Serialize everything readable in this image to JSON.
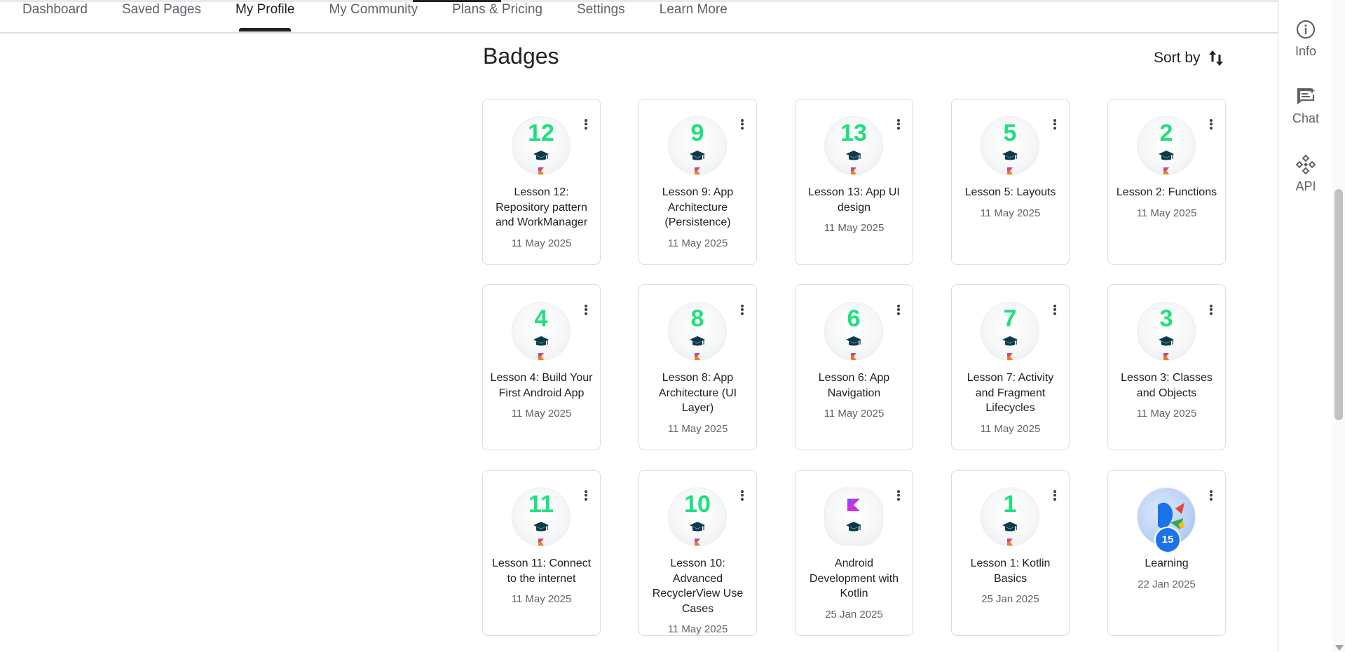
{
  "nav": {
    "tabs": [
      {
        "label": "Dashboard"
      },
      {
        "label": "Saved Pages"
      },
      {
        "label": "My Profile",
        "active": true
      },
      {
        "label": "My Community"
      },
      {
        "label": "Plans & Pricing"
      },
      {
        "label": "Settings"
      },
      {
        "label": "Learn More"
      }
    ]
  },
  "rail": {
    "info": "Info",
    "chat": "Chat",
    "api": "API"
  },
  "badges": {
    "title": "Badges",
    "sort_label": "Sort by",
    "accent_color": "#1ee07d",
    "items": [
      {
        "number": "12",
        "title": "Lesson 12: Repository pattern and WorkManager",
        "date": "11 May 2025"
      },
      {
        "number": "9",
        "title": "Lesson 9: App Architecture (Persistence)",
        "date": "11 May 2025"
      },
      {
        "number": "13",
        "title": "Lesson 13: App UI design",
        "date": "11 May 2025"
      },
      {
        "number": "5",
        "title": "Lesson 5: Layouts",
        "date": "11 May 2025"
      },
      {
        "number": "2",
        "title": "Lesson 2: Functions",
        "date": "11 May 2025"
      },
      {
        "number": "4",
        "title": "Lesson 4: Build Your First Android App",
        "date": "11 May 2025"
      },
      {
        "number": "8",
        "title": "Lesson 8: App Architecture (UI Layer)",
        "date": "11 May 2025"
      },
      {
        "number": "6",
        "title": "Lesson 6: App Navigation",
        "date": "11 May 2025"
      },
      {
        "number": "7",
        "title": "Lesson 7: Activity and Fragment Lifecycles",
        "date": "11 May 2025"
      },
      {
        "number": "3",
        "title": "Lesson 3: Classes and Objects",
        "date": "11 May 2025"
      },
      {
        "number": "11",
        "title": "Lesson 11: Connect to the internet",
        "date": "11 May 2025"
      },
      {
        "number": "10",
        "title": "Lesson 10: Advanced RecyclerView Use Cases",
        "date": "11 May 2025"
      },
      {
        "number": "",
        "title": "Android Development with Kotlin",
        "date": "25 Jan 2025",
        "kind": "course"
      },
      {
        "number": "1",
        "title": "Lesson 1: Kotlin Basics",
        "date": "25 Jan 2025"
      },
      {
        "number": "15",
        "title": "Learning",
        "date": "22 Jan 2025",
        "kind": "learning"
      }
    ]
  }
}
